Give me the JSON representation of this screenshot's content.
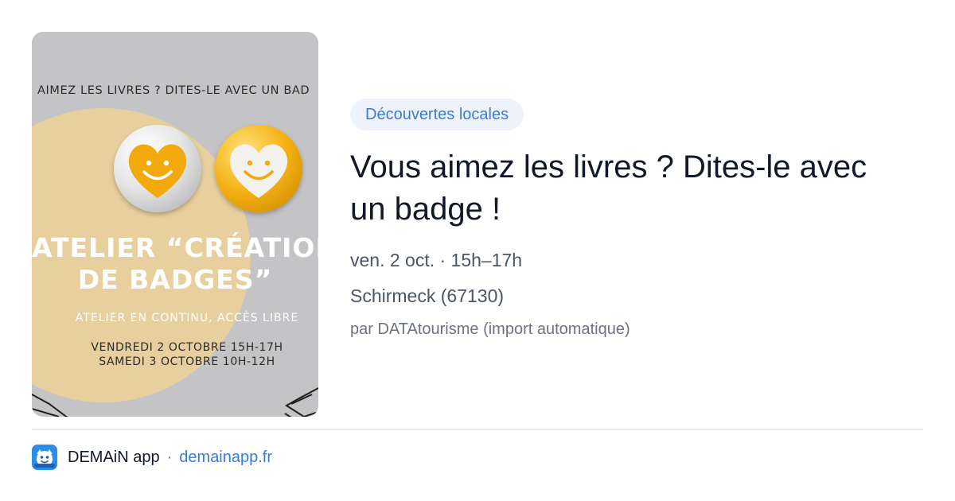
{
  "poster": {
    "top_line": "AIMEZ LES LIVRES ? DITES-LE AVEC UN BAD",
    "title_line1": "ATELIER “CRÉATION",
    "title_line2": "DE BADGES”",
    "subtitle": "ATELIER EN CONTINU, ACCÈS LIBRE",
    "date_line1": "VENDREDI 2 OCTOBRE 15H-17H",
    "date_line2": "SAMEDI 3 OCTOBRE 10H-12H"
  },
  "event": {
    "category": "Découvertes locales",
    "title": "Vous aimez les livres ? Dites-le avec un badge !",
    "when": "ven. 2 oct. · 15h–17h",
    "where": "Schirmeck (67130)",
    "source": "par DATAtourisme (import automatique)"
  },
  "footer": {
    "app_icon": "demain-app-icon",
    "app_name": "DEMAiN app",
    "separator": "·",
    "domain": "demainapp.fr"
  },
  "colors": {
    "accent": "#3a7bd5",
    "category_bg": "#eef3fb",
    "title": "#111827",
    "meta": "#4b5563"
  }
}
